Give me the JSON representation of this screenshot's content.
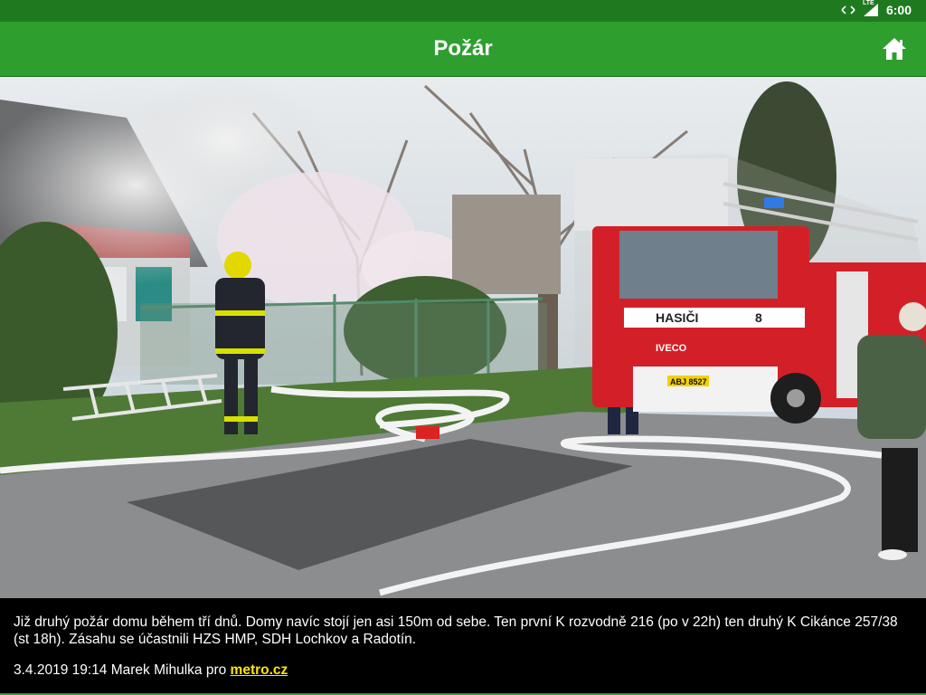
{
  "status_bar": {
    "time": "6:00",
    "network_label": "LTE",
    "icons": [
      "data-transfer-icon",
      "signal-icon"
    ]
  },
  "app_bar": {
    "title": "Požár",
    "home_icon": "home-icon"
  },
  "photo": {
    "truck_door_label": "HASIČI",
    "truck_number": "8",
    "truck_brand": "IVECO",
    "license_plate": "ABJ 8527"
  },
  "caption": {
    "text": "Již druhý požár domu během tří dnů. Domy navíc stojí jen asi 150m od sebe. Ten první K rozvodně 216 (po v 22h) ten druhý K Cikánce 257/38 (st 18h). Zásahu se účastnili HZS HMP, SDH Lochkov a Radotín.",
    "date_author": "3.4.2019 19:14 Marek Mihulka pro",
    "source_link": "metro.cz"
  },
  "colors": {
    "status_bar": "#1f7a1f",
    "app_bar": "#2e9e2e",
    "link": "#ffe600"
  }
}
